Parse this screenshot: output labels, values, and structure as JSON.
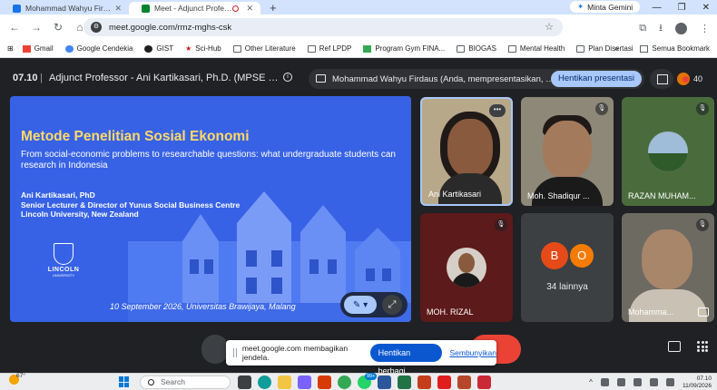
{
  "browser": {
    "tabs": [
      {
        "title": "Mohammad Wahyu Firdaus - Goo",
        "favicon_color": "#1a73e8",
        "active": false
      },
      {
        "title": "Meet - Adjunct Professor -",
        "favicon_color": "#00832d",
        "active": true
      }
    ],
    "new_tab_symbol": "+",
    "gemini_label": "Minta Gemini",
    "url": "meet.google.com/rmz-mghs-csk",
    "bookmarks": [
      {
        "label": "Gmail",
        "icon": "gmail-icon",
        "color": "#ea4335"
      },
      {
        "label": "Google Cendekia",
        "icon": "scholar-icon",
        "color": "#4285f4"
      },
      {
        "label": "GIST",
        "icon": "github-icon",
        "color": "#1f1f1f"
      },
      {
        "label": "Sci-Hub",
        "icon": "scihub-icon",
        "color": "#c5221f"
      },
      {
        "label": "Other Literature",
        "icon": "folder-icon",
        "color": ""
      },
      {
        "label": "Ref LPDP",
        "icon": "folder-icon",
        "color": ""
      },
      {
        "label": "Program Gym FINA...",
        "icon": "gym-icon",
        "color": "#34a853"
      },
      {
        "label": "BIOGAS",
        "icon": "folder-icon",
        "color": ""
      },
      {
        "label": "Mental Health",
        "icon": "folder-icon",
        "color": ""
      },
      {
        "label": "Plan Disertasi",
        "icon": "folder-icon",
        "color": ""
      }
    ],
    "bookmarks_overflow": "»",
    "all_bookmarks": "Semua Bookmark"
  },
  "meet": {
    "time": "07.10",
    "separator": "|",
    "meeting_title": "Adjunct Professor - Ani Kartikasari, Ph.D. (MPSE - P...",
    "presenting_text": "Mohammad Wahyu Firdaus (Anda, mempresentasikan, me...",
    "stop_presenting": "Hentikan presentasi",
    "participant_count": "40",
    "slide": {
      "title": "Metode Penelitian Sosial Ekonomi",
      "subtitle": "From social-economic problems to researchable questions: what undergraduate students can research in Indonesia",
      "author_lines": [
        "Ani Kartikasari, PhD",
        "Senior Lecturer & Director of Yunus Social Business Centre",
        "Lincoln University, New Zealand"
      ],
      "logo_name": "LINCOLN",
      "logo_sub": "UNIVERSITY",
      "date_place": "10 September 2026, Universitas Brawijaya, Malang",
      "color_title": "#ffd966",
      "color_bg": "#3762e6"
    },
    "participants": [
      {
        "name": "Ani Kartikasari",
        "muted": false,
        "speaking": true
      },
      {
        "name": "Moh. Shadiqur ...",
        "muted": true
      },
      {
        "name": "RAZAN MUHAM...",
        "muted": true
      },
      {
        "name": "MOH. RIZAL",
        "muted": true
      },
      {
        "others_initials": [
          "B",
          "O"
        ],
        "others_label": "34 lainnya"
      },
      {
        "name": "Mohamma...",
        "muted": true
      }
    ],
    "share_notice": {
      "text": "meet.google.com membagikan jendela.",
      "stop_sharing": "Hentikan berbagi",
      "hide": "Sembunyikan"
    }
  },
  "taskbar": {
    "temperature": "67°",
    "search_placeholder": "Search",
    "badge": "99+",
    "clock_time": "07.10",
    "clock_date": "11/09/2026"
  }
}
